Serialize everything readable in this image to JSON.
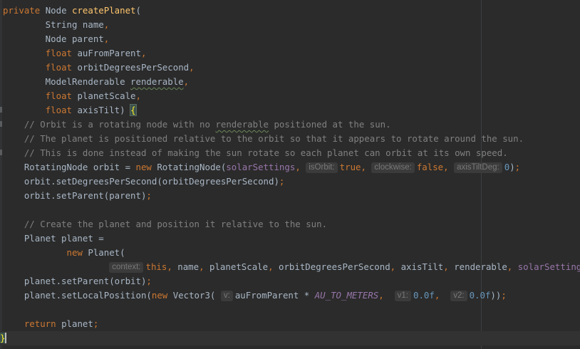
{
  "editor": {
    "lines": [
      {
        "tokens": [
          {
            "t": "private ",
            "c": "kw"
          },
          {
            "t": "Node ",
            "c": ""
          },
          {
            "t": "createPlanet",
            "c": "fn"
          },
          {
            "t": "(",
            "c": ""
          }
        ]
      },
      {
        "tokens": [
          {
            "t": "        String name",
            "c": ""
          },
          {
            "t": ",",
            "c": "kw"
          }
        ]
      },
      {
        "tokens": [
          {
            "t": "        Node parent",
            "c": ""
          },
          {
            "t": ",",
            "c": "kw"
          }
        ]
      },
      {
        "tokens": [
          {
            "t": "        ",
            "c": ""
          },
          {
            "t": "float ",
            "c": "kw"
          },
          {
            "t": "auFromParent",
            "c": ""
          },
          {
            "t": ",",
            "c": "kw"
          }
        ]
      },
      {
        "tokens": [
          {
            "t": "        ",
            "c": ""
          },
          {
            "t": "float ",
            "c": "kw"
          },
          {
            "t": "orbitDegreesPerSecond",
            "c": ""
          },
          {
            "t": ",",
            "c": "kw"
          }
        ]
      },
      {
        "tokens": [
          {
            "t": "        ModelRenderable ",
            "c": ""
          },
          {
            "t": "renderable",
            "c": "typo"
          },
          {
            "t": ",",
            "c": "kw"
          }
        ]
      },
      {
        "tokens": [
          {
            "t": "        ",
            "c": ""
          },
          {
            "t": "float ",
            "c": "kw"
          },
          {
            "t": "planetScale",
            "c": ""
          },
          {
            "t": ",",
            "c": "kw"
          }
        ]
      },
      {
        "tokens": [
          {
            "t": "        ",
            "c": ""
          },
          {
            "t": "float ",
            "c": "kw"
          },
          {
            "t": "axisTilt) ",
            "c": ""
          },
          {
            "t": "{",
            "c": "brace-match"
          }
        ]
      },
      {
        "tokens": [
          {
            "t": "    // Orbit is a rotating node with no ",
            "c": "cm"
          },
          {
            "t": "renderable",
            "c": "cm typo"
          },
          {
            "t": " positioned at the sun.",
            "c": "cm"
          }
        ]
      },
      {
        "tokens": [
          {
            "t": "    // The planet is positioned relative to the orbit so that it appears to rotate around the sun.",
            "c": "cm"
          }
        ]
      },
      {
        "tokens": [
          {
            "t": "    // This is done instead of making the sun rotate so each planet can orbit at its own speed.",
            "c": "cm"
          }
        ]
      },
      {
        "tokens": [
          {
            "t": "    RotatingNode orbit = ",
            "c": ""
          },
          {
            "t": "new ",
            "c": "kw"
          },
          {
            "t": "RotatingNode(",
            "c": ""
          },
          {
            "t": "solarSettings",
            "c": "purp"
          },
          {
            "t": ", ",
            "c": "kw"
          },
          {
            "t": "isOrbit:",
            "c": "hint"
          },
          {
            "t": "true",
            "c": "kw"
          },
          {
            "t": ", ",
            "c": "kw"
          },
          {
            "t": "clockwise:",
            "c": "hint"
          },
          {
            "t": "false",
            "c": "kw"
          },
          {
            "t": ", ",
            "c": "kw"
          },
          {
            "t": "axisTiltDeg:",
            "c": "hint"
          },
          {
            "t": "0",
            "c": "num"
          },
          {
            "t": ")",
            "c": ""
          },
          {
            "t": ";",
            "c": "kw"
          }
        ]
      },
      {
        "tokens": [
          {
            "t": "    orbit.setDegreesPerSecond(orbitDegreesPerSecond)",
            "c": ""
          },
          {
            "t": ";",
            "c": "kw"
          }
        ]
      },
      {
        "tokens": [
          {
            "t": "    orbit.setParent(parent)",
            "c": ""
          },
          {
            "t": ";",
            "c": "kw"
          }
        ]
      },
      {
        "tokens": [
          {
            "t": "",
            "c": ""
          }
        ]
      },
      {
        "tokens": [
          {
            "t": "    // Create the planet and position it relative to the sun.",
            "c": "cm"
          }
        ]
      },
      {
        "tokens": [
          {
            "t": "    Planet planet =",
            "c": ""
          }
        ]
      },
      {
        "tokens": [
          {
            "t": "            ",
            "c": ""
          },
          {
            "t": "new ",
            "c": "kw"
          },
          {
            "t": "Planet(",
            "c": ""
          }
        ]
      },
      {
        "tokens": [
          {
            "t": "                    ",
            "c": ""
          },
          {
            "t": "context:",
            "c": "hint"
          },
          {
            "t": "this",
            "c": "kw"
          },
          {
            "t": ", ",
            "c": "kw"
          },
          {
            "t": "name",
            "c": ""
          },
          {
            "t": ", ",
            "c": "kw"
          },
          {
            "t": "planetScale",
            "c": ""
          },
          {
            "t": ", ",
            "c": "kw"
          },
          {
            "t": "orbitDegreesPerSecond",
            "c": ""
          },
          {
            "t": ", ",
            "c": "kw"
          },
          {
            "t": "axisTilt",
            "c": ""
          },
          {
            "t": ", ",
            "c": "kw"
          },
          {
            "t": "renderable",
            "c": ""
          },
          {
            "t": ", ",
            "c": "kw"
          },
          {
            "t": "solarSettings",
            "c": "purp"
          },
          {
            "t": ")",
            "c": ""
          },
          {
            "t": ";",
            "c": "kw"
          }
        ]
      },
      {
        "tokens": [
          {
            "t": "    planet.setParent(orbit)",
            "c": ""
          },
          {
            "t": ";",
            "c": "kw"
          }
        ]
      },
      {
        "tokens": [
          {
            "t": "    planet.setLocalPosition(",
            "c": ""
          },
          {
            "t": "new ",
            "c": "kw"
          },
          {
            "t": "Vector3( ",
            "c": ""
          },
          {
            "t": "v:",
            "c": "hint"
          },
          {
            "t": "auFromParent * ",
            "c": ""
          },
          {
            "t": "AU_TO_METERS",
            "c": "ital"
          },
          {
            "t": ",  ",
            "c": "kw"
          },
          {
            "t": "v1:",
            "c": "hint"
          },
          {
            "t": "0.0f",
            "c": "num"
          },
          {
            "t": ",  ",
            "c": "kw"
          },
          {
            "t": "v2:",
            "c": "hint"
          },
          {
            "t": "0.0f",
            "c": "num"
          },
          {
            "t": "))",
            "c": ""
          },
          {
            "t": ";",
            "c": "kw"
          }
        ]
      },
      {
        "tokens": [
          {
            "t": "",
            "c": ""
          }
        ]
      },
      {
        "tokens": [
          {
            "t": "    ",
            "c": ""
          },
          {
            "t": "return ",
            "c": "kw"
          },
          {
            "t": "planet",
            "c": ""
          },
          {
            "t": ";",
            "c": "kw"
          }
        ]
      },
      {
        "tokens": [
          {
            "t": "}",
            "c": "brace-end"
          }
        ]
      }
    ]
  }
}
